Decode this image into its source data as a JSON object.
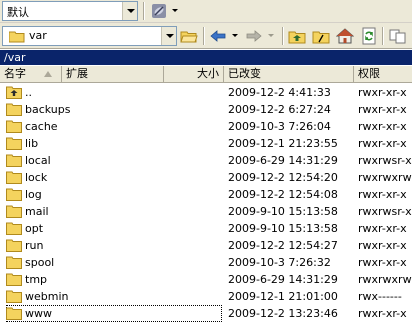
{
  "toolbar1": {
    "session_combo_value": "默认",
    "sync_icon": "satellite-dish-icon"
  },
  "toolbar2": {
    "path_combo_value": "var",
    "buttons": [
      "folder-open-icon",
      "back-arrow-icon",
      "forward-arrow-icon",
      "parent-folder-icon",
      "root-folder-icon",
      "home-icon",
      "refresh-icon",
      "filter-icon"
    ]
  },
  "path_bar": {
    "text": "/var"
  },
  "header": {
    "name": "名字",
    "ext": "扩展",
    "size": "大小",
    "modified": "已改变",
    "perms": "权限"
  },
  "files": [
    {
      "name": "..",
      "modified": "2009-12-2 4:41:33",
      "perms": "rwxr-xr-x",
      "icon": "parent-folder-icon"
    },
    {
      "name": "backups",
      "modified": "2009-12-2 6:27:24",
      "perms": "rwxr-xr-x",
      "icon": "folder-icon"
    },
    {
      "name": "cache",
      "modified": "2009-10-3 7:26:04",
      "perms": "rwxr-xr-x",
      "icon": "folder-icon"
    },
    {
      "name": "lib",
      "modified": "2009-12-1 21:23:55",
      "perms": "rwxr-xr-x",
      "icon": "folder-icon"
    },
    {
      "name": "local",
      "modified": "2009-6-29 14:31:29",
      "perms": "rwxrwsr-x",
      "icon": "folder-icon"
    },
    {
      "name": "lock",
      "modified": "2009-12-2 12:54:20",
      "perms": "rwxrwxrwt",
      "icon": "folder-icon"
    },
    {
      "name": "log",
      "modified": "2009-12-2 12:54:08",
      "perms": "rwxr-xr-x",
      "icon": "folder-icon"
    },
    {
      "name": "mail",
      "modified": "2009-9-10 15:13:58",
      "perms": "rwxrwsr-x",
      "icon": "folder-icon"
    },
    {
      "name": "opt",
      "modified": "2009-9-10 15:13:58",
      "perms": "rwxr-xr-x",
      "icon": "folder-icon"
    },
    {
      "name": "run",
      "modified": "2009-12-2 12:54:27",
      "perms": "rwxr-xr-x",
      "icon": "folder-icon"
    },
    {
      "name": "spool",
      "modified": "2009-10-3 7:26:32",
      "perms": "rwxr-xr-x",
      "icon": "folder-icon"
    },
    {
      "name": "tmp",
      "modified": "2009-6-29 14:31:29",
      "perms": "rwxrwxrwt",
      "icon": "folder-icon"
    },
    {
      "name": "webmin",
      "modified": "2009-12-1 21:01:00",
      "perms": "rwx------",
      "icon": "folder-icon"
    },
    {
      "name": "www",
      "modified": "2009-12-2 13:23:46",
      "perms": "rwxr-xr-x",
      "icon": "folder-icon"
    }
  ],
  "colors": {
    "path_bar_bg": "#0a246a",
    "toolbar_bg": "#ece9d8",
    "folder_yellow": "#f4d35e"
  }
}
